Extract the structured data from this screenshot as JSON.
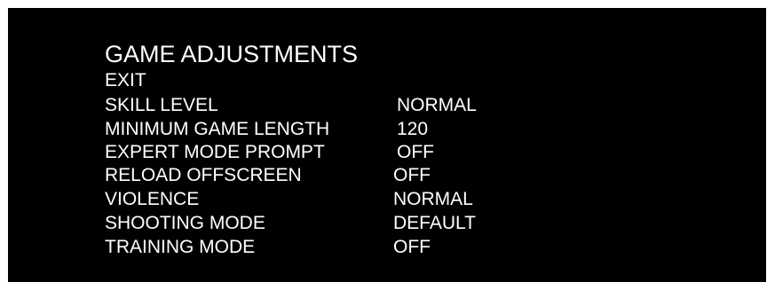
{
  "menu": {
    "title": "GAME ADJUSTMENTS",
    "items": [
      {
        "label": "EXIT",
        "value": ""
      },
      {
        "label": "SKILL LEVEL",
        "value": "NORMAL"
      },
      {
        "label": "MINIMUM GAME LENGTH",
        "value": "120"
      },
      {
        "label": "EXPERT MODE PROMPT",
        "value": "OFF"
      },
      {
        "label": "RELOAD OFFSCREEN",
        "value": "OFF"
      },
      {
        "label": "VIOLENCE",
        "value": "NORMAL"
      },
      {
        "label": "SHOOTING MODE",
        "value": "DEFAULT"
      },
      {
        "label": "TRAINING MODE",
        "value": "OFF"
      }
    ]
  }
}
